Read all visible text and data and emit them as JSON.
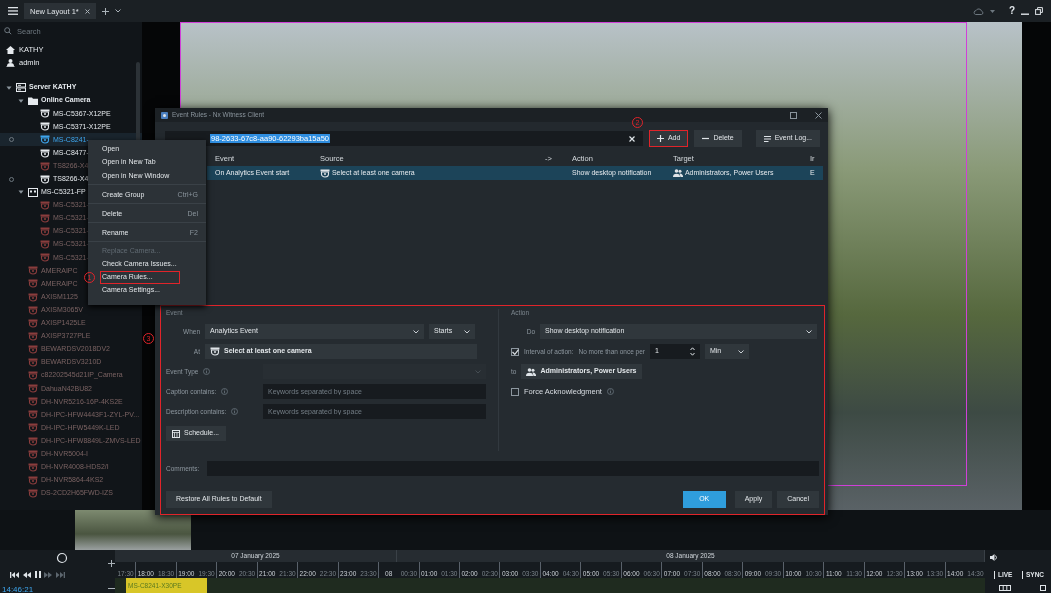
{
  "top_bar": {
    "tabs": [
      {
        "label": "New Layout 1*",
        "selected": true
      }
    ],
    "help_glyph": "?"
  },
  "sidebar": {
    "search_placeholder": "Search",
    "user_items": [
      {
        "kind": "home",
        "label": "KATHY"
      },
      {
        "kind": "user",
        "label": "admin"
      }
    ],
    "tree": [
      {
        "kind": "server",
        "label": "Server KATHY",
        "expanded": true,
        "selected": false,
        "online": true,
        "children": [
          {
            "kind": "folder",
            "label": "Online Camera",
            "expanded": true,
            "selected": false,
            "online": true,
            "children": [
              {
                "kind": "camera",
                "label": "MS-C5367-X12PE",
                "selected": false,
                "online": true,
                "recording": false
              },
              {
                "kind": "camera",
                "label": "MS-C5371-X12PE",
                "selected": false,
                "online": true,
                "recording": false
              },
              {
                "kind": "camera",
                "label": "MS-C8241-",
                "selected": true,
                "online": true,
                "recording": true
              },
              {
                "kind": "camera",
                "label": "MS-C8477-",
                "selected": false,
                "online": true,
                "recording": false
              },
              {
                "kind": "camera",
                "label": "TS8266-X4",
                "selected": false,
                "online": false,
                "recording": false
              },
              {
                "kind": "camera",
                "label": "TS8266-X4",
                "selected": false,
                "online": true,
                "recording": true
              }
            ]
          },
          {
            "kind": "device_group",
            "label": "MS-C5321-FP",
            "expanded": true,
            "selected": false,
            "online": true,
            "children": [
              {
                "kind": "camera",
                "label": "MS-C5321-",
                "selected": false,
                "online": false,
                "recording": false
              },
              {
                "kind": "camera",
                "label": "MS-C5321-",
                "selected": false,
                "online": false,
                "recording": false
              },
              {
                "kind": "camera",
                "label": "MS-C5321-",
                "selected": false,
                "online": false,
                "recording": false
              },
              {
                "kind": "camera",
                "label": "MS-C5321-",
                "selected": false,
                "online": false,
                "recording": false
              },
              {
                "kind": "camera",
                "label": "MS-C5321-",
                "selected": false,
                "online": false,
                "recording": false
              }
            ]
          },
          {
            "kind": "camera",
            "label": "AMERAIPC",
            "selected": false,
            "online": false,
            "recording": false
          },
          {
            "kind": "camera",
            "label": "AMERAIPC",
            "selected": false,
            "online": false,
            "recording": false
          },
          {
            "kind": "camera",
            "label": "AXISM1125",
            "selected": false,
            "online": false,
            "recording": false
          },
          {
            "kind": "camera",
            "label": "AXISM3065V",
            "selected": false,
            "online": false,
            "recording": false
          },
          {
            "kind": "camera",
            "label": "AXISP1425LE",
            "selected": false,
            "online": false,
            "recording": false
          },
          {
            "kind": "camera",
            "label": "AXISP3727PLE",
            "selected": false,
            "online": false,
            "recording": false
          },
          {
            "kind": "camera",
            "label": "BEWARDSV2018DV2",
            "selected": false,
            "online": false,
            "recording": false
          },
          {
            "kind": "camera",
            "label": "BEWARDSV3210D",
            "selected": false,
            "online": false,
            "recording": false
          },
          {
            "kind": "camera",
            "label": "c82202545d21IP_Camera",
            "selected": false,
            "online": false,
            "recording": false
          },
          {
            "kind": "camera",
            "label": "DahuaN42BU82",
            "selected": false,
            "online": false,
            "recording": false
          },
          {
            "kind": "camera",
            "label": "DH-NVR5216-16P-4KS2E",
            "selected": false,
            "online": false,
            "recording": false
          },
          {
            "kind": "camera",
            "label": "DH-IPC-HFW4443F1-ZYL-PV...",
            "selected": false,
            "online": false,
            "recording": false
          },
          {
            "kind": "camera",
            "label": "DH-IPC-HFW5449K-LED",
            "selected": false,
            "online": false,
            "recording": false
          },
          {
            "kind": "camera",
            "label": "DH-IPC-HFW8849L-ZMVS-LED",
            "selected": false,
            "online": false,
            "recording": false
          },
          {
            "kind": "camera",
            "label": "DH-NVR5004-I",
            "selected": false,
            "online": false,
            "recording": false
          },
          {
            "kind": "camera",
            "label": "DH-NVR4008-HDS2/I",
            "selected": false,
            "online": false,
            "recording": false
          },
          {
            "kind": "camera",
            "label": "DH-NVR5864-4KS2",
            "selected": false,
            "online": false,
            "recording": false
          },
          {
            "kind": "camera",
            "label": "DS-2CD2H65FWD-IZS",
            "selected": false,
            "online": false,
            "recording": false
          }
        ]
      }
    ]
  },
  "context_menu": {
    "items": [
      {
        "label": "Open",
        "disabled": false,
        "separator_after": false
      },
      {
        "label": "Open in New Tab",
        "disabled": false,
        "separator_after": false
      },
      {
        "label": "Open in New Window",
        "disabled": false,
        "separator_after": true
      },
      {
        "label": "Create Group",
        "shortcut": "Ctrl+G",
        "disabled": false,
        "separator_after": true
      },
      {
        "label": "Delete",
        "shortcut": "Del",
        "disabled": false,
        "separator_after": true
      },
      {
        "label": "Rename",
        "shortcut": "F2",
        "disabled": false,
        "separator_after": true
      },
      {
        "label": "Replace Camera...",
        "disabled": true,
        "separator_after": false
      },
      {
        "label": "Check Camera Issues...",
        "disabled": false,
        "separator_after": false
      },
      {
        "label": "Camera Rules...",
        "disabled": false,
        "separator_after": false,
        "outlined": true,
        "callout": "1"
      },
      {
        "label": "Camera Settings...",
        "disabled": false,
        "separator_after": false
      }
    ]
  },
  "dialog": {
    "title": "Event Rules - Nx Witness Client",
    "search_value": "98-2633-67c8-aa90-62293ba15a50",
    "toolbar_buttons": [
      {
        "kind": "add",
        "label": "Add",
        "outlined": true,
        "callout": "2"
      },
      {
        "kind": "delete",
        "label": "Delete"
      },
      {
        "kind": "log",
        "label": "Event Log..."
      }
    ],
    "table": {
      "columns": [
        "Event",
        "Source",
        "->",
        "Action",
        "Target",
        "Ir"
      ],
      "rows": [
        {
          "selected": true,
          "event": "On Analytics Event start",
          "source": "Select at least one camera",
          "action": "Show desktop notification",
          "target": "Administrators, Power Users",
          "column_6": "E"
        }
      ]
    },
    "editor": {
      "outlined": true,
      "callout": "3",
      "event_panel": {
        "title": "Event",
        "when_label": "When",
        "when_value": "Analytics Event",
        "when_mode": "Starts",
        "at_label": "At",
        "at_value": "Select at least one camera",
        "event_type_label": "Event Type",
        "event_type_disabled": true,
        "caption_label": "Caption contains:",
        "caption_placeholder": "Keywords separated by space",
        "description_label": "Description contains:",
        "description_placeholder": "Keywords separated by space",
        "schedule_button": "Schedule..."
      },
      "action_panel": {
        "title": "Action",
        "do_label": "Do",
        "do_value": "Show desktop notification",
        "interval_checked": true,
        "interval_label": "Interval of action:",
        "interval_text": "No more than once per",
        "interval_value": "1",
        "interval_unit": "Min",
        "to_label": "to",
        "to_value": "Administrators, Power Users",
        "force_ack_label": "Force Acknowledgment",
        "force_ack_checked": false
      },
      "comments_label": "Comments:"
    },
    "footer": {
      "restore_button": "Restore All Rules to Default",
      "buttons": [
        {
          "label": "OK",
          "primary": true
        },
        {
          "label": "Apply",
          "primary": false
        },
        {
          "label": "Cancel",
          "primary": false
        }
      ]
    }
  },
  "timeline": {
    "current_time": "14:46:21",
    "dates": [
      "07 January 2025",
      "08 January 2025"
    ],
    "ticks": [
      {
        "label": "17:30",
        "major": false
      },
      {
        "label": "18:00",
        "major": true
      },
      {
        "label": "18:30",
        "major": false
      },
      {
        "label": "19:00",
        "major": true
      },
      {
        "label": "19:30",
        "major": false
      },
      {
        "label": "20:00",
        "major": true
      },
      {
        "label": "20:30",
        "major": false
      },
      {
        "label": "21:00",
        "major": true
      },
      {
        "label": "21:30",
        "major": false
      },
      {
        "label": "22:00",
        "major": true
      },
      {
        "label": "22:30",
        "major": false
      },
      {
        "label": "23:00",
        "major": true
      },
      {
        "label": "23:30",
        "major": false
      },
      {
        "label": "08",
        "major": true
      },
      {
        "label": "00:30",
        "major": false
      },
      {
        "label": "01:00",
        "major": true
      },
      {
        "label": "01:30",
        "major": false
      },
      {
        "label": "02:00",
        "major": true
      },
      {
        "label": "02:30",
        "major": false
      },
      {
        "label": "03:00",
        "major": true
      },
      {
        "label": "03:30",
        "major": false
      },
      {
        "label": "04:00",
        "major": true
      },
      {
        "label": "04:30",
        "major": false
      },
      {
        "label": "05:00",
        "major": true
      },
      {
        "label": "05:30",
        "major": false
      },
      {
        "label": "06:00",
        "major": true
      },
      {
        "label": "06:30",
        "major": false
      },
      {
        "label": "07:00",
        "major": true
      },
      {
        "label": "07:30",
        "major": false
      },
      {
        "label": "08:00",
        "major": true
      },
      {
        "label": "08:30",
        "major": false
      },
      {
        "label": "09:00",
        "major": true
      },
      {
        "label": "09:30",
        "major": false
      },
      {
        "label": "10:00",
        "major": true
      },
      {
        "label": "10:30",
        "major": false
      },
      {
        "label": "11:00",
        "major": true
      },
      {
        "label": "11:30",
        "major": false
      },
      {
        "label": "12:00",
        "major": true
      },
      {
        "label": "12:30",
        "major": false
      },
      {
        "label": "13:00",
        "major": true
      },
      {
        "label": "13:30",
        "major": false
      },
      {
        "label": "14:00",
        "major": true
      },
      {
        "label": "14:30",
        "major": false
      }
    ],
    "track_label": "MS-C8241-X30PE",
    "live_label": "LIVE",
    "sync_label": "SYNC"
  }
}
